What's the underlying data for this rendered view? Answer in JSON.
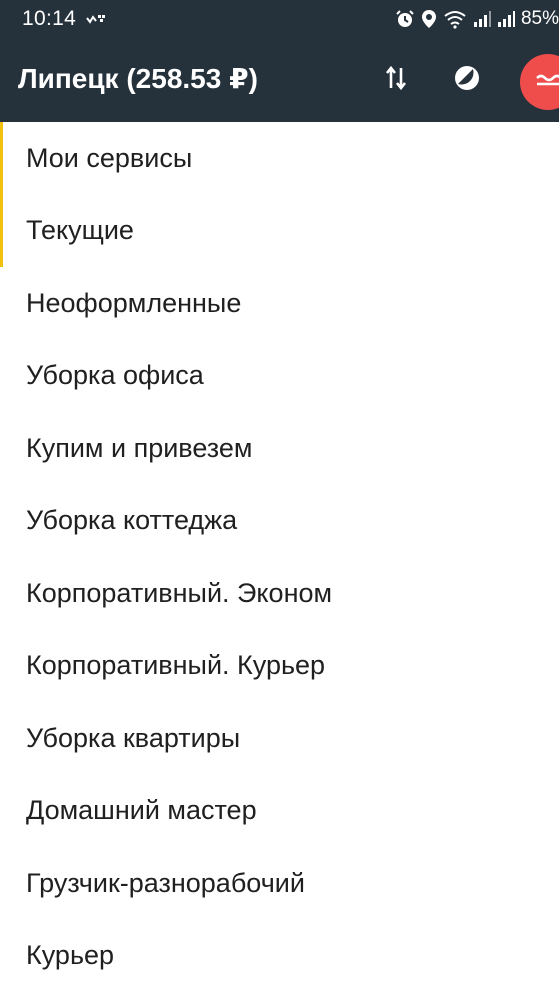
{
  "status_bar": {
    "time": "10:14",
    "battery": "85%",
    "icons": [
      "notification-icon",
      "alarm-icon",
      "location-icon",
      "wifi-icon",
      "signal-icon",
      "signal-icon-2"
    ]
  },
  "app_bar": {
    "title": "Липецк (258.53 ₽)",
    "actions": [
      "swap-arrows-icon",
      "shift-toggle-icon",
      "red-action-icon"
    ],
    "accent_color": "#ef4c4c",
    "background": "#25313b"
  },
  "menu": {
    "accent_color": "#f2c00f",
    "items": [
      {
        "label": "Мои сервисы"
      },
      {
        "label": "Текущие"
      },
      {
        "label": "Неоформленные"
      },
      {
        "label": "Уборка офиса"
      },
      {
        "label": "Купим и привезем"
      },
      {
        "label": "Уборка коттеджа"
      },
      {
        "label": "Корпоративный. Эконом"
      },
      {
        "label": "Корпоративный. Курьер"
      },
      {
        "label": "Уборка квартиры"
      },
      {
        "label": "Домашний мастер"
      },
      {
        "label": "Грузчик-разнорабочий"
      },
      {
        "label": "Курьер"
      }
    ]
  }
}
